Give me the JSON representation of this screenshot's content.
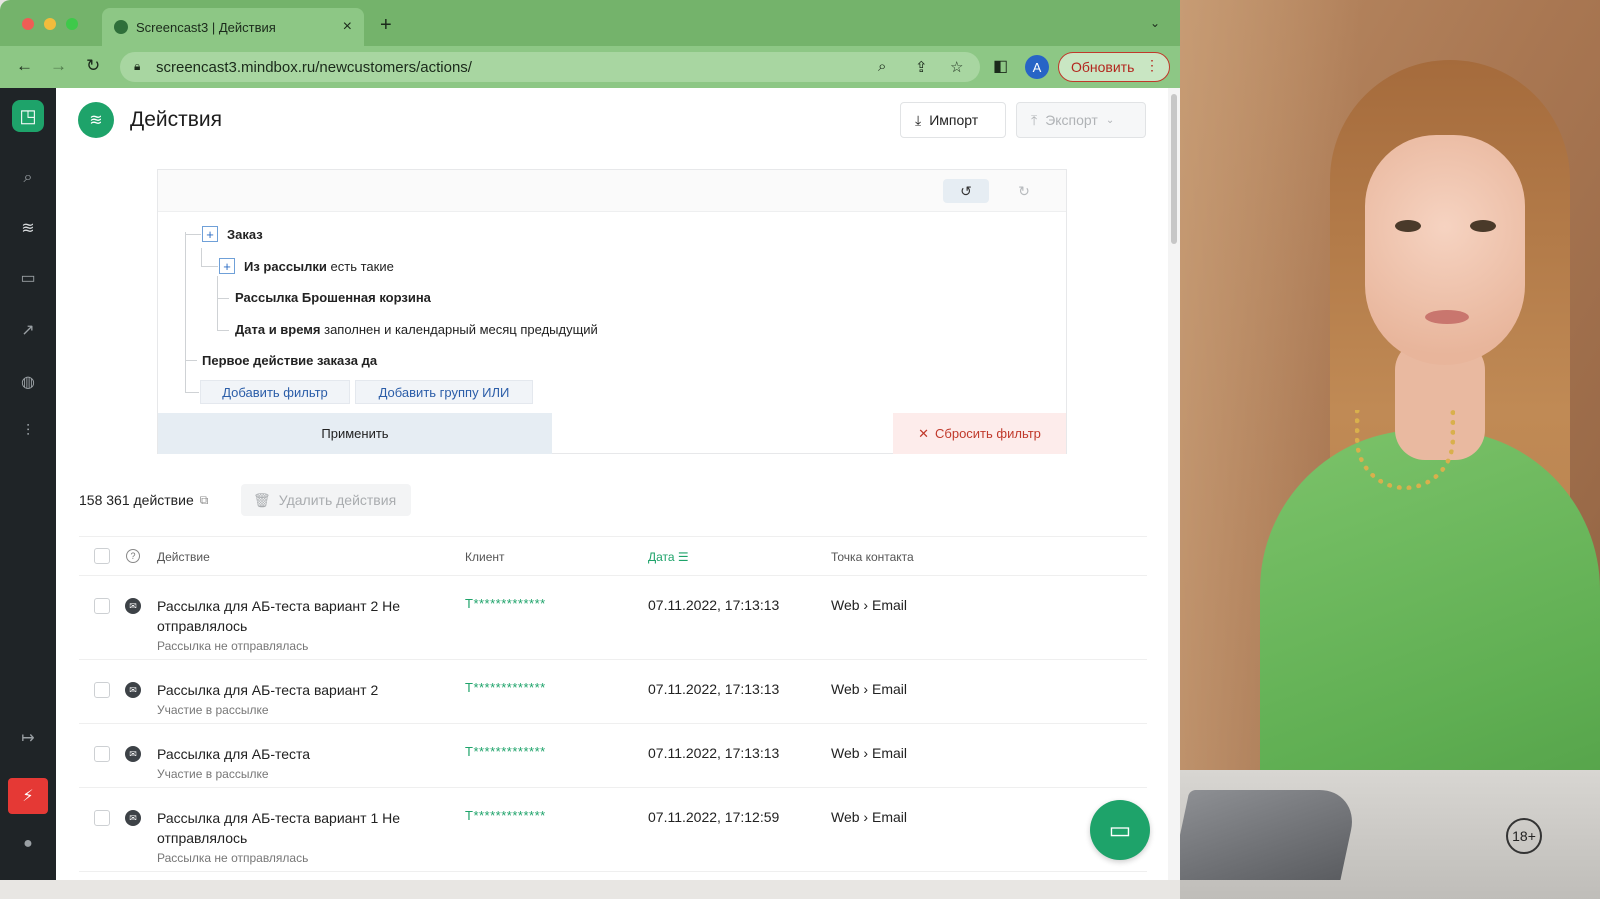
{
  "browser": {
    "tab_title": "Screencast3 | Действия",
    "url": "screencast3.mindbox.ru/newcustomers/actions/",
    "avatar_letter": "A",
    "update_label": "Обновить"
  },
  "page": {
    "title": "Действия",
    "import_label": "Импорт",
    "export_label": "Экспорт"
  },
  "filter": {
    "rows": [
      {
        "bold": "Заказ",
        "rest": ""
      },
      {
        "bold": "Из рассылки",
        "rest": " есть такие"
      },
      {
        "bold": "Рассылка",
        "rest": "  Брошенная корзина"
      },
      {
        "bold": "Дата и время",
        "rest": " заполнен и календарный месяц предыдущий"
      },
      {
        "bold": "Первое действие заказа",
        "rest": " да"
      }
    ],
    "add_filter_label": "Добавить фильтр",
    "add_or_group_label": "Добавить группу ИЛИ",
    "apply_label": "Применить",
    "reset_label": "Сбросить фильтр"
  },
  "summary": {
    "count_label": "158 361 действие",
    "delete_label": "Удалить действия"
  },
  "table": {
    "headers": {
      "action": "Действие",
      "client": "Клиент",
      "date": "Дата",
      "touchpoint": "Точка контакта"
    },
    "rows": [
      {
        "title": "Рассылка для АБ-теста вариант 2 Не отправлялось",
        "sub": "Рассылка не отправлялась",
        "client": "Т*************",
        "date": "07.11.2022, 17:13:13",
        "touch_from": "Web",
        "touch_to": "Email"
      },
      {
        "title": "Рассылка для АБ-теста вариант 2",
        "sub": "Участие в рассылке",
        "client": "Т*************",
        "date": "07.11.2022, 17:13:13",
        "touch_from": "Web",
        "touch_to": "Email"
      },
      {
        "title": "Рассылка для АБ-теста",
        "sub": "Участие в рассылке",
        "client": "Т*************",
        "date": "07.11.2022, 17:13:13",
        "touch_from": "Web",
        "touch_to": "Email"
      },
      {
        "title": "Рассылка для АБ-теста вариант 1 Не отправлялось",
        "sub": "Рассылка не отправлялась",
        "client": "Т*************",
        "date": "07.11.2022, 17:12:59",
        "touch_from": "Web",
        "touch_to": "Email"
      }
    ]
  },
  "video": {
    "age_badge": "18+"
  },
  "colors": {
    "brand": "#1ea36a",
    "browser_chrome": "#74b36b",
    "danger": "#c0392b",
    "rail": "#1f2427"
  },
  "icons": [
    "search-icon",
    "layers-icon",
    "briefcase-icon",
    "chart-icon",
    "globe-icon",
    "sliders-icon",
    "logout-icon",
    "bolt-icon",
    "user-icon",
    "chat-icon"
  ]
}
